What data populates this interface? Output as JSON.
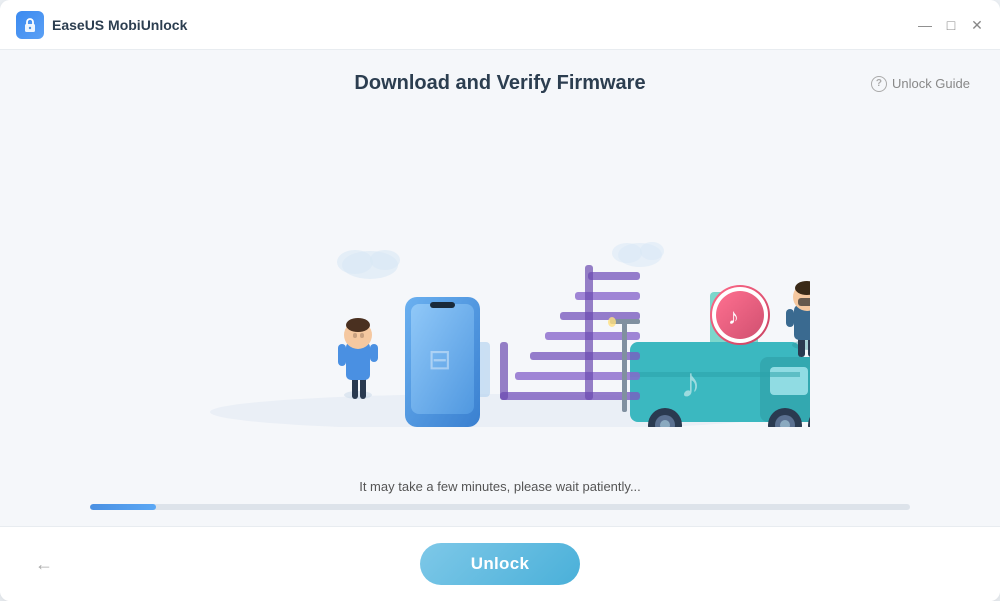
{
  "app": {
    "title": "EaseUS MobiUnlock",
    "logo_icon": "lock-icon"
  },
  "titlebar": {
    "minimize_label": "—",
    "maximize_label": "□",
    "close_label": "✕"
  },
  "header": {
    "page_title": "Download and Verify Firmware",
    "unlock_guide_label": "Unlock Guide",
    "help_symbol": "?"
  },
  "progress": {
    "status_text": "It may take a few minutes, please wait patiently...",
    "percent": 8
  },
  "footer": {
    "back_icon": "←",
    "unlock_button_label": "Unlock"
  },
  "illustration": {
    "description": "Animated scene with person, phone, conveyor belt, and truck"
  }
}
